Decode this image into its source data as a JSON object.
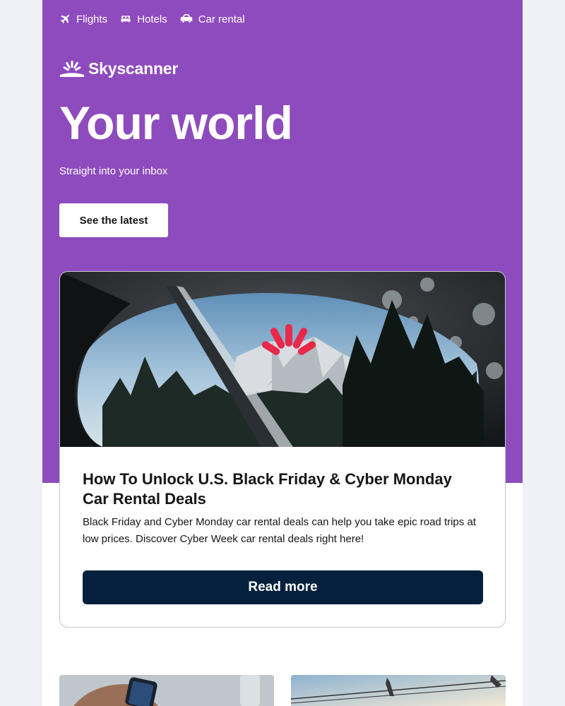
{
  "nav": {
    "items": [
      {
        "label": "Flights",
        "icon": "plane-icon"
      },
      {
        "label": "Hotels",
        "icon": "bed-icon"
      },
      {
        "label": "Car rental",
        "icon": "car-icon"
      }
    ]
  },
  "brand": {
    "name": "Skyscanner",
    "logo_icon": "sunrise-logo-icon"
  },
  "hero": {
    "title": "Your world",
    "subtitle": "Straight into your inbox",
    "button_label": "See the latest"
  },
  "article": {
    "title": "How To Unlock U.S. Black Friday & Cyber Monday Car Rental Deals",
    "body": "Black Friday and Cyber Monday car rental deals can help you take epic road trips at low prices. Discover Cyber Week car rental deals right here!",
    "button_label": "Read more",
    "image_icon": "car-mirror-mountain-photo"
  },
  "colors": {
    "hero_background": "#8e4bbd",
    "page_background": "#eff1f6",
    "button_dark": "#05203c",
    "accent_red": "#e8294a"
  }
}
